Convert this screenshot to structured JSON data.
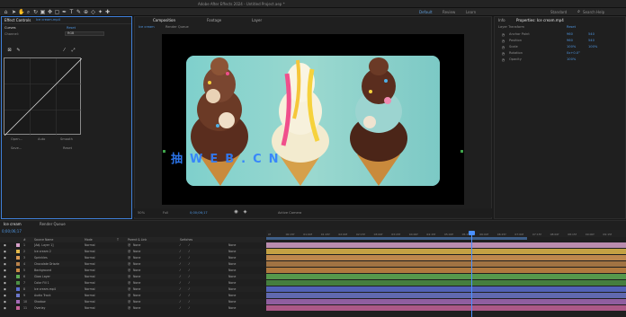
{
  "app": {
    "title": "Adobe After Effects 2024 - Untitled Project.aep *",
    "workspaces": [
      "Default",
      "Review",
      "Learn",
      "Standard"
    ],
    "search_label": "Search Help"
  },
  "toolbar": {
    "tools": [
      "home-icon",
      "selection-tool-icon",
      "hand-tool-icon",
      "zoom-tool-icon",
      "rotate-tool-icon",
      "camera-tool-icon",
      "pan-behind-tool-icon",
      "mask-tool-icon",
      "pen-tool-icon",
      "type-tool-icon",
      "brush-tool-icon",
      "clone-tool-icon",
      "eraser-tool-icon",
      "roto-tool-icon",
      "puppet-tool-icon"
    ]
  },
  "effect_controls": {
    "tab_label": "Effect Controls",
    "layer_label": "Ice cream.mp4",
    "effect_name": "Curves",
    "reset_label": "Reset",
    "channel_label": "Channel:",
    "channel_value": "RGB",
    "buttons": [
      "Open...",
      "Auto",
      "Smooth",
      "Save...",
      "Reset"
    ]
  },
  "composition": {
    "tab_label": "Composition",
    "comp_name": "Ice cream",
    "sub_tabs": [
      "Ice cream",
      "Footage",
      "Layer"
    ],
    "breadcrumb": [
      "Ice cream",
      "Render Queue"
    ],
    "footer": {
      "zoom": "50%",
      "resolution": "Full",
      "timecode": "0;00;06;17",
      "camera": "Active Camera"
    }
  },
  "right_panel": {
    "tabs": [
      "Info",
      "Properties: Ice cream.mp4"
    ],
    "section": "Layer Transform",
    "reset_label": "Reset",
    "props": [
      {
        "name": "Anchor Point",
        "value": "960",
        "value2": "540"
      },
      {
        "name": "Position",
        "value": "960",
        "value2": "540"
      },
      {
        "name": "Scale",
        "value": "100%",
        "value2": "100%"
      },
      {
        "name": "Rotation",
        "value": "0x+0.0°",
        "value2": ""
      },
      {
        "name": "Opacity",
        "value": "100%",
        "value2": ""
      }
    ]
  },
  "timeline": {
    "tab_label": "Ice cream",
    "render_queue": "Render Queue",
    "timecode": "0;00;06;17",
    "columns": [
      "#",
      "Source Name",
      "Mode",
      "T",
      "Parent & Link",
      "Switches"
    ],
    "layers": [
      {
        "num": "1",
        "name": "[Adj. Layer 1]",
        "mode": "Normal",
        "parent": "None",
        "color": "#d6a0c8"
      },
      {
        "num": "2",
        "name": "Ice cream 2",
        "mode": "Normal",
        "parent": "None",
        "color": "#e2b84a"
      },
      {
        "num": "3",
        "name": "Sprinkles",
        "mode": "Normal",
        "parent": "None",
        "color": "#d99a56"
      },
      {
        "num": "4",
        "name": "Chocolate Drizzle",
        "mode": "Normal",
        "parent": "None",
        "color": "#b8824a"
      },
      {
        "num": "5",
        "name": "Background",
        "mode": "Normal",
        "parent": "None",
        "color": "#c98a44"
      },
      {
        "num": "6",
        "name": "Glow Layer",
        "mode": "Normal",
        "parent": "None",
        "color": "#5fae55"
      },
      {
        "num": "7",
        "name": "Color Fill 1",
        "mode": "Normal",
        "parent": "None",
        "color": "#4c8f44"
      },
      {
        "num": "8",
        "name": "Ice cream.mp4",
        "mode": "Normal",
        "parent": "None",
        "color": "#5a6ed1"
      },
      {
        "num": "9",
        "name": "Audio Track",
        "mode": "Normal",
        "parent": "None",
        "color": "#6c77c9"
      },
      {
        "num": "10",
        "name": "Shadow",
        "mode": "Normal",
        "parent": "None",
        "color": "#a46ab7"
      },
      {
        "num": "11",
        "name": "Overlay",
        "mode": "Normal",
        "parent": "None",
        "color": "#c6639a"
      }
    ],
    "ruler": [
      "0f",
      "00:15f",
      "01:00f",
      "01:15f",
      "02:00f",
      "02:15f",
      "03:00f",
      "03:15f",
      "04:00f",
      "04:15f",
      "05:00f",
      "05:15f",
      "06:00f",
      "06:15f",
      "07:00f",
      "07:15f",
      "08:00f",
      "08:15f",
      "09:00f",
      "09:15f"
    ]
  }
}
